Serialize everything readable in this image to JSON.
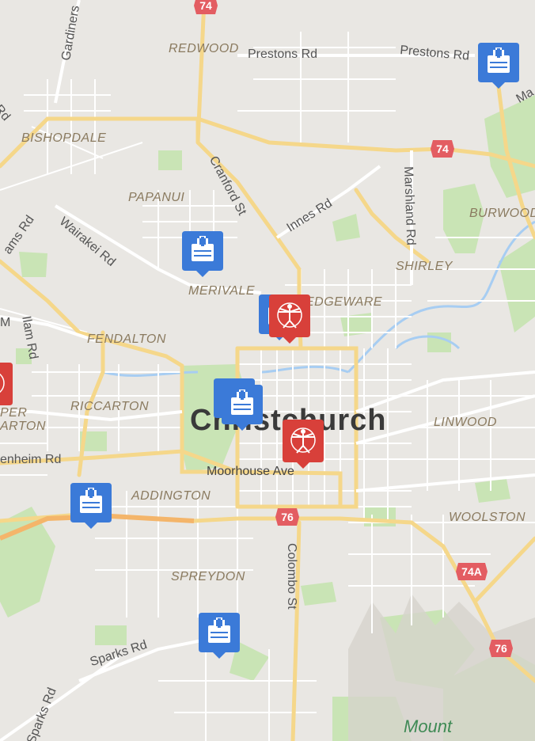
{
  "map": {
    "city": "Christchurch",
    "suburbs": [
      "REDWOOD",
      "BISHOPDALE",
      "PAPANUI",
      "MERIVALE",
      "EDGEWARE",
      "FENDALTON",
      "RICCARTON",
      "PER",
      "ARTON",
      "ADDINGTON",
      "SPREYDON",
      "BURWOOD",
      "SHIRLEY",
      "LINWOOD",
      "WOOLSTON"
    ],
    "roads": [
      "Prestons Rd",
      "Prestons Rd",
      "Cranford St",
      "Innes Rd",
      "Marshland Rd",
      "Wairakei Rd",
      "Ilam Rd",
      "enheim Rd",
      "Moorhouse Ave",
      "Colombo St",
      "Sparks Rd",
      "Sparks Rd",
      "Gardiners",
      "ams Rd",
      "Ma",
      "Rd",
      "M"
    ],
    "shields": [
      "74",
      "74",
      "76",
      "74A",
      "76"
    ],
    "natural": [
      "Mount"
    ],
    "colors": {
      "land": "#e9e7e3",
      "major_road": "#f5d78a",
      "minor_road": "#ffffff",
      "park": "#c9e4b5",
      "water": "#a7cdf2",
      "hospital_pin": "#3b7ad8",
      "physio_pin": "#d8403a"
    }
  },
  "markers": [
    {
      "type": "hospital",
      "icon": "hospital-icon"
    },
    {
      "type": "hospital",
      "icon": "hospital-icon"
    },
    {
      "type": "hospital",
      "icon": "hospital-icon"
    },
    {
      "type": "hospital",
      "icon": "hospital-icon"
    },
    {
      "type": "hospital",
      "icon": "hospital-icon"
    },
    {
      "type": "hospital",
      "icon": "hospital-icon"
    },
    {
      "type": "physio",
      "icon": "vitruvian-man-icon"
    },
    {
      "type": "physio",
      "icon": "vitruvian-man-icon"
    },
    {
      "type": "physio",
      "icon": "vitruvian-man-icon"
    }
  ]
}
